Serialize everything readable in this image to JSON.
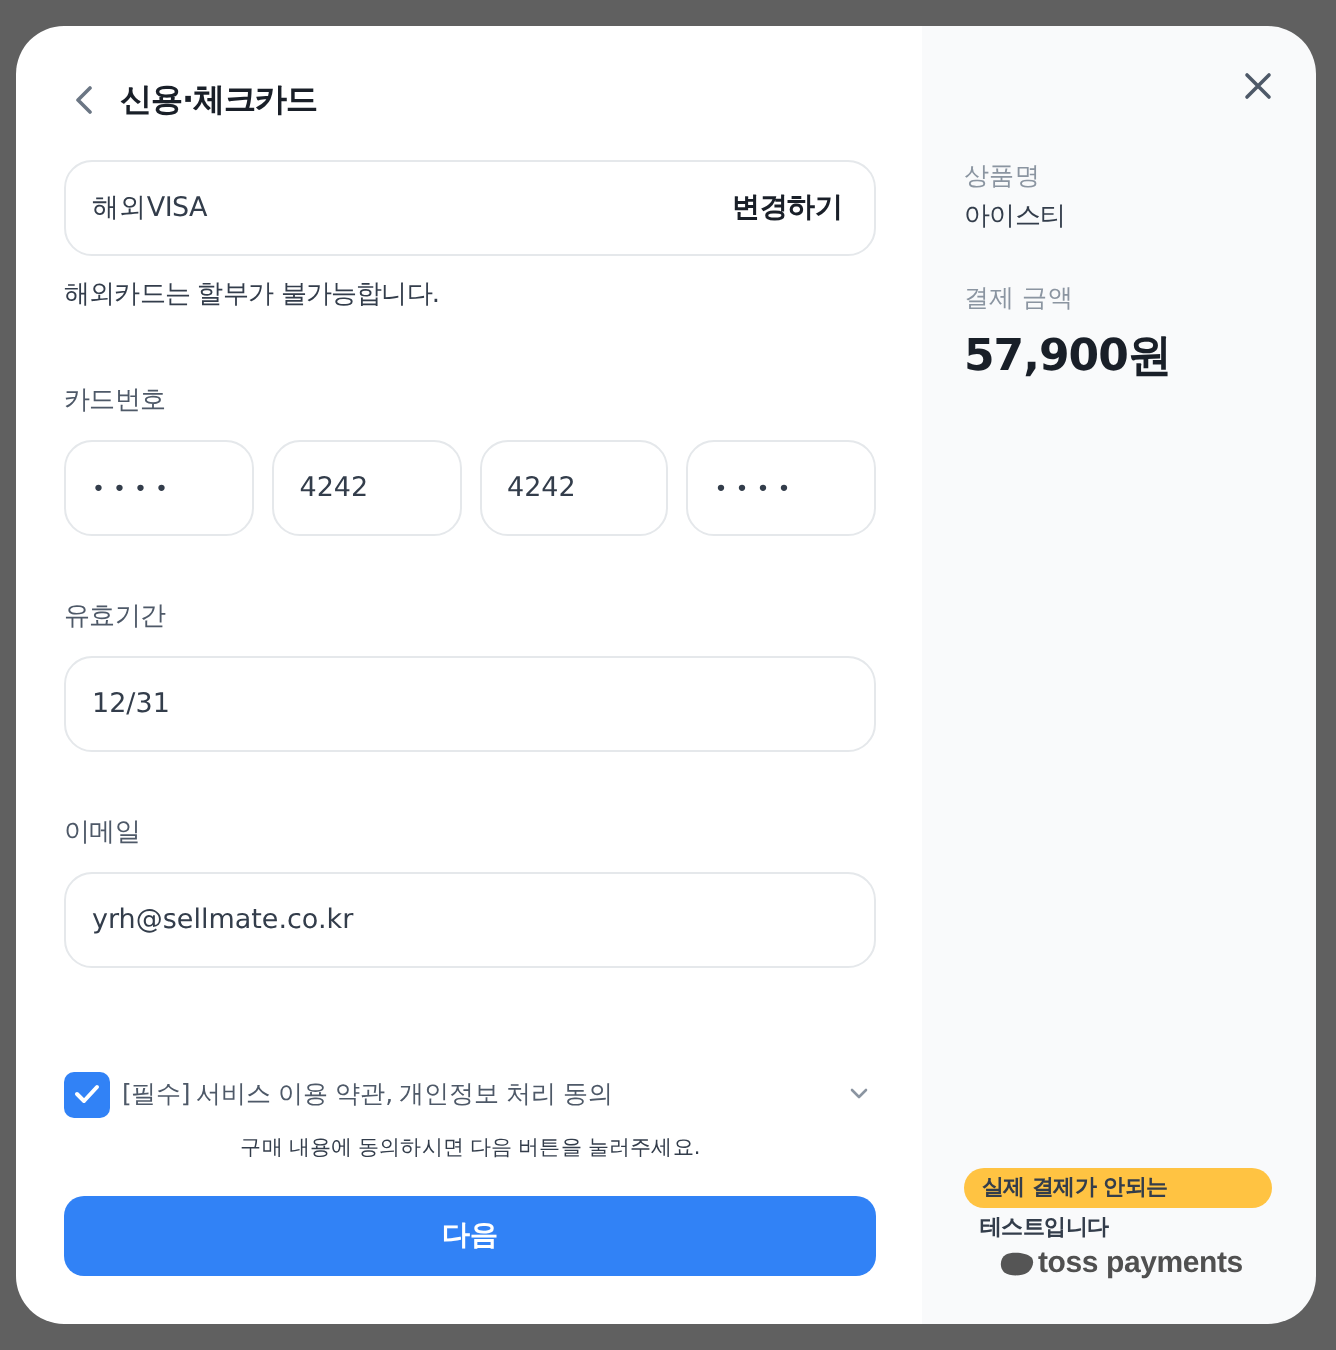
{
  "header": {
    "title": "신용·체크카드"
  },
  "card_type": {
    "value": "해외VISA",
    "action": "변경하기"
  },
  "notice": "해외카드는 할부가 불가능합니다.",
  "card_number": {
    "label": "카드번호",
    "segments": [
      {
        "value": "••••",
        "masked": true
      },
      {
        "value": "4242",
        "masked": false
      },
      {
        "value": "4242",
        "masked": false
      },
      {
        "value": "••••",
        "masked": true
      }
    ]
  },
  "expiry": {
    "label": "유효기간",
    "value": "12/31"
  },
  "email": {
    "label": "이메일",
    "value": "yrh@sellmate.co.kr"
  },
  "agreement": {
    "label": "[필수] 서비스 이용 약관, 개인정보 처리 동의",
    "checked": true,
    "expanded": false,
    "hint": "구매 내용에 동의하시면 다음 버튼을 눌러주세요."
  },
  "next_button": "다음",
  "summary": {
    "product_label": "상품명",
    "product": "아이스티",
    "amount_label": "결제 금액",
    "amount": "57,900원"
  },
  "test_notice": {
    "badge": "실제 결제가 안되는",
    "text": "테스트입니다"
  },
  "brand": {
    "name": "toss payments"
  }
}
